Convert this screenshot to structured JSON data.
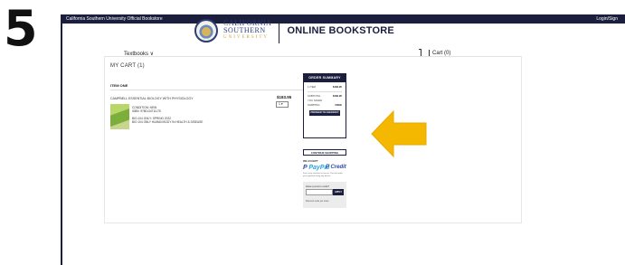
{
  "step": "5",
  "topbar": {
    "left": "California Southern University Official Bookstore",
    "right": "Login/Sign"
  },
  "brand": {
    "line1": "CALIFORNIA",
    "line2": "SOUTHERN",
    "line3": "UNIVERSITY",
    "store": "ONLINE BOOKSTORE"
  },
  "nav": {
    "textbooks": "Textbooks ∨",
    "cart": "Cart (0)"
  },
  "cart": {
    "heading": "MY CART (1)",
    "item_label": "ITEM ONE",
    "title": "CAMPBELL ESSENTIAL BIOLOGY WITH PHYSIOLOGY",
    "price": "$183.95",
    "qty": "1",
    "condition_line1": "CONDITION: NEW",
    "condition_line2": "ISBN: 9780134711175",
    "section_line1": "BIO-104 ONLY: SPRING 2022",
    "section_line2": "BIO 104 ONLY HUMAN BODY IN HEALTH & DISEASE"
  },
  "summary": {
    "title": "ORDER SUMMARY",
    "items_label": "1 ITEM",
    "items_value": "$183.95",
    "subtotal_label": "SUBTOTAL",
    "subtotal_value": "$183.95",
    "saved_label": "YOU SAVED",
    "shipping_label": "SHIPPING",
    "shipping_value": "FREE",
    "checkout": "PROCEED TO CHECKOUT"
  },
  "continue": "CONTINUE SHOPPING",
  "we_accept": "WE ACCEPT",
  "paypal_a": "PayPal",
  "paypal_b": "Credit",
  "pay_note": "Fast, easy checkout is secure. You can make your payment using any device.",
  "promo": {
    "question": "Have a promo code?",
    "apply": "APPLY",
    "discount": "Discount code per order"
  },
  "colors": {
    "navy": "#1b1f3d",
    "arrow": "#f5b800"
  }
}
